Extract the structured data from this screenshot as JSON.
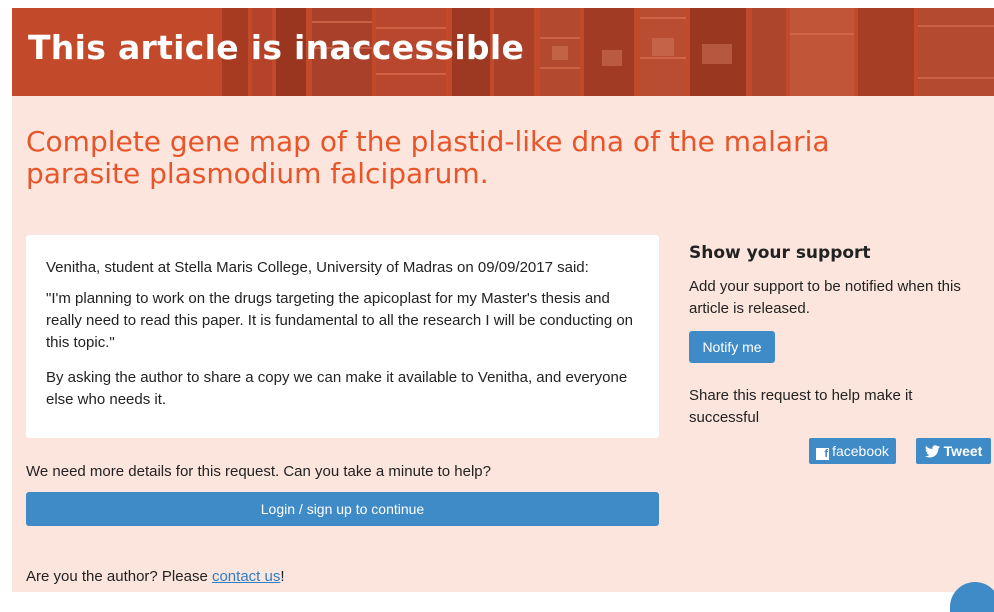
{
  "banner": {
    "title": "This article is inaccessible"
  },
  "article": {
    "title": "Complete gene map of the plastid-like dna of the malaria parasite plasmodium falciparum."
  },
  "request": {
    "author_line": "Venitha, student at Stella Maris College, University of Madras on 09/09/2017 said:",
    "quote": "\"I'm planning to work on the drugs targeting the apicoplast for my Master's thesis and really need to read this paper. It is fundamental to all the research I will be conducting on this topic.\"",
    "ask": "By asking the author to share a copy we can make it available to Venitha, and everyone else who needs it."
  },
  "details": {
    "prompt": "We need more details for this request. Can you take a minute to help?",
    "login_button": "Login / sign up to continue"
  },
  "author_prompt": {
    "prefix": "Are you the author? Please ",
    "link": "contact us",
    "suffix": "!"
  },
  "sidebar": {
    "support_title": "Show your support",
    "support_text": "Add your support to be notified when this article is released.",
    "notify_button": "Notify me",
    "share_text": "Share this request to help make it successful",
    "facebook_button": "facebook",
    "tweet_button": "Tweet"
  },
  "colors": {
    "accent": "#e8552a",
    "banner": "#c2492a",
    "button": "#3e8bc8",
    "background": "#fbe5dc"
  }
}
